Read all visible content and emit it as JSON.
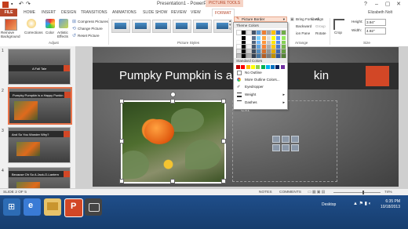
{
  "window": {
    "title": "Presentation1 - PowerPoint",
    "context_tab_header": "PICTURE TOOLS",
    "user": "Elizabeth Nolt",
    "controls": [
      "?",
      "–",
      "▢",
      "✕"
    ]
  },
  "tabs": [
    "FILE",
    "HOME",
    "INSERT",
    "DESIGN",
    "TRANSITIONS",
    "ANIMATIONS",
    "SLIDE SHOW",
    "REVIEW",
    "VIEW",
    "FORMAT"
  ],
  "ribbon": {
    "remove_background": "Remove Background",
    "corrections": "Corrections",
    "color": "Color",
    "artistic_effects": "Artistic Effects",
    "compress": "Compress Pictures",
    "change": "Change Picture",
    "reset": "Reset Picture",
    "adjust_label": "Adjust",
    "picture_styles_label": "Picture Styles",
    "picture_border": "Picture Border",
    "bring_forward": "Bring Forward",
    "send_backward": "Backward",
    "selection_pane": "ion Pane",
    "align": "Align",
    "group": "Group",
    "rotate": "Rotate",
    "arrange_label": "Arrange",
    "crop": "Crop",
    "height_label": "Height:",
    "height_value": "3.94\"",
    "width_label": "Width:",
    "width_value": "4.92\"",
    "size_label": "Size"
  },
  "border_menu": {
    "theme_colors_label": "Theme Colors",
    "standard_colors_label": "Standard Colors",
    "items": [
      "No Outline",
      "More Outline Colors...",
      "Eyedropper",
      "Weight",
      "Dashes"
    ],
    "theme_colors": [
      "#ffffff",
      "#000000",
      "#e7e6e6",
      "#44546a",
      "#5b9bd5",
      "#ed7d31",
      "#a5a5a5",
      "#ffc000",
      "#4472c4",
      "#70ad47"
    ],
    "standard_colors": [
      "#c00000",
      "#ff0000",
      "#ffc000",
      "#ffff00",
      "#92d050",
      "#00b050",
      "#00b0f0",
      "#0070c0",
      "#002060",
      "#7030a0"
    ]
  },
  "thumbnails": [
    {
      "num": "1",
      "title": "A Fall Tale"
    },
    {
      "num": "2",
      "title": "Pumpky Pumpkin is a Happy Punkin"
    },
    {
      "num": "3",
      "title": "And So You Wonder Why?"
    },
    {
      "num": "4",
      "title": "Because Oh So A Jack-O-Lantern"
    }
  ],
  "slide": {
    "title": "Pumpky Pumpkin is a Hap",
    "title_tail": "kin",
    "content_placeholder": "ext"
  },
  "status": {
    "slide_info": "SLIDE 2 OF 5",
    "notes": "NOTES",
    "comments": "COMMENTS",
    "zoom": "74%"
  },
  "taskbar": {
    "desktop": "Desktop",
    "time": "6:35 PM",
    "date": "10/18/2013"
  },
  "colors": {
    "accent": "#b7472a",
    "slide_accent": "#d24726",
    "taskbar": "#1f4e8a"
  }
}
